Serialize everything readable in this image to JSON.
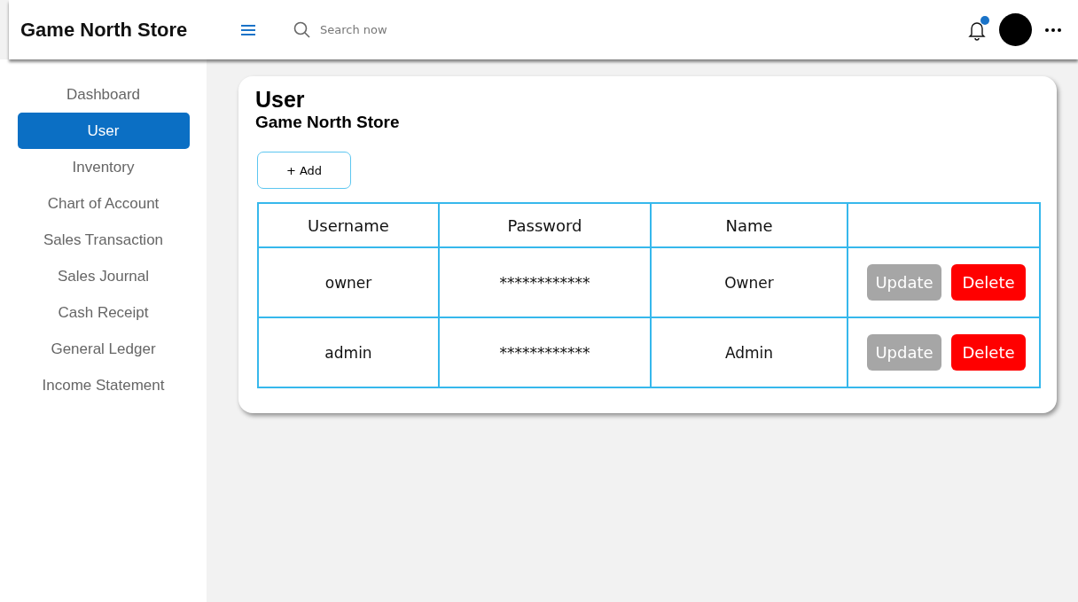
{
  "header": {
    "brand": "Game North Store",
    "search": {
      "placeholder": "Search now"
    },
    "notification_dot": true
  },
  "sidebar": {
    "items": [
      {
        "label": "Dashboard",
        "selected": false
      },
      {
        "label": "User",
        "selected": true
      },
      {
        "label": "Inventory",
        "selected": false
      },
      {
        "label": "Chart of Account",
        "selected": false
      },
      {
        "label": "Sales Transaction",
        "selected": false
      },
      {
        "label": "Sales Journal",
        "selected": false
      },
      {
        "label": "Cash Receipt",
        "selected": false
      },
      {
        "label": "General Ledger",
        "selected": false
      },
      {
        "label": "Income Statement",
        "selected": false
      }
    ]
  },
  "card": {
    "title": "User",
    "subtitle": "Game North Store",
    "add_button": "+ Add",
    "table": {
      "columns": [
        "Username",
        "Password",
        "Name"
      ],
      "rows": [
        {
          "username": "owner",
          "password": "************",
          "name": "Owner",
          "actions": [
            "Update",
            "Delete"
          ]
        },
        {
          "username": "admin",
          "password": "************",
          "name": "Admin",
          "actions": [
            "Update",
            "Delete"
          ]
        }
      ]
    }
  }
}
